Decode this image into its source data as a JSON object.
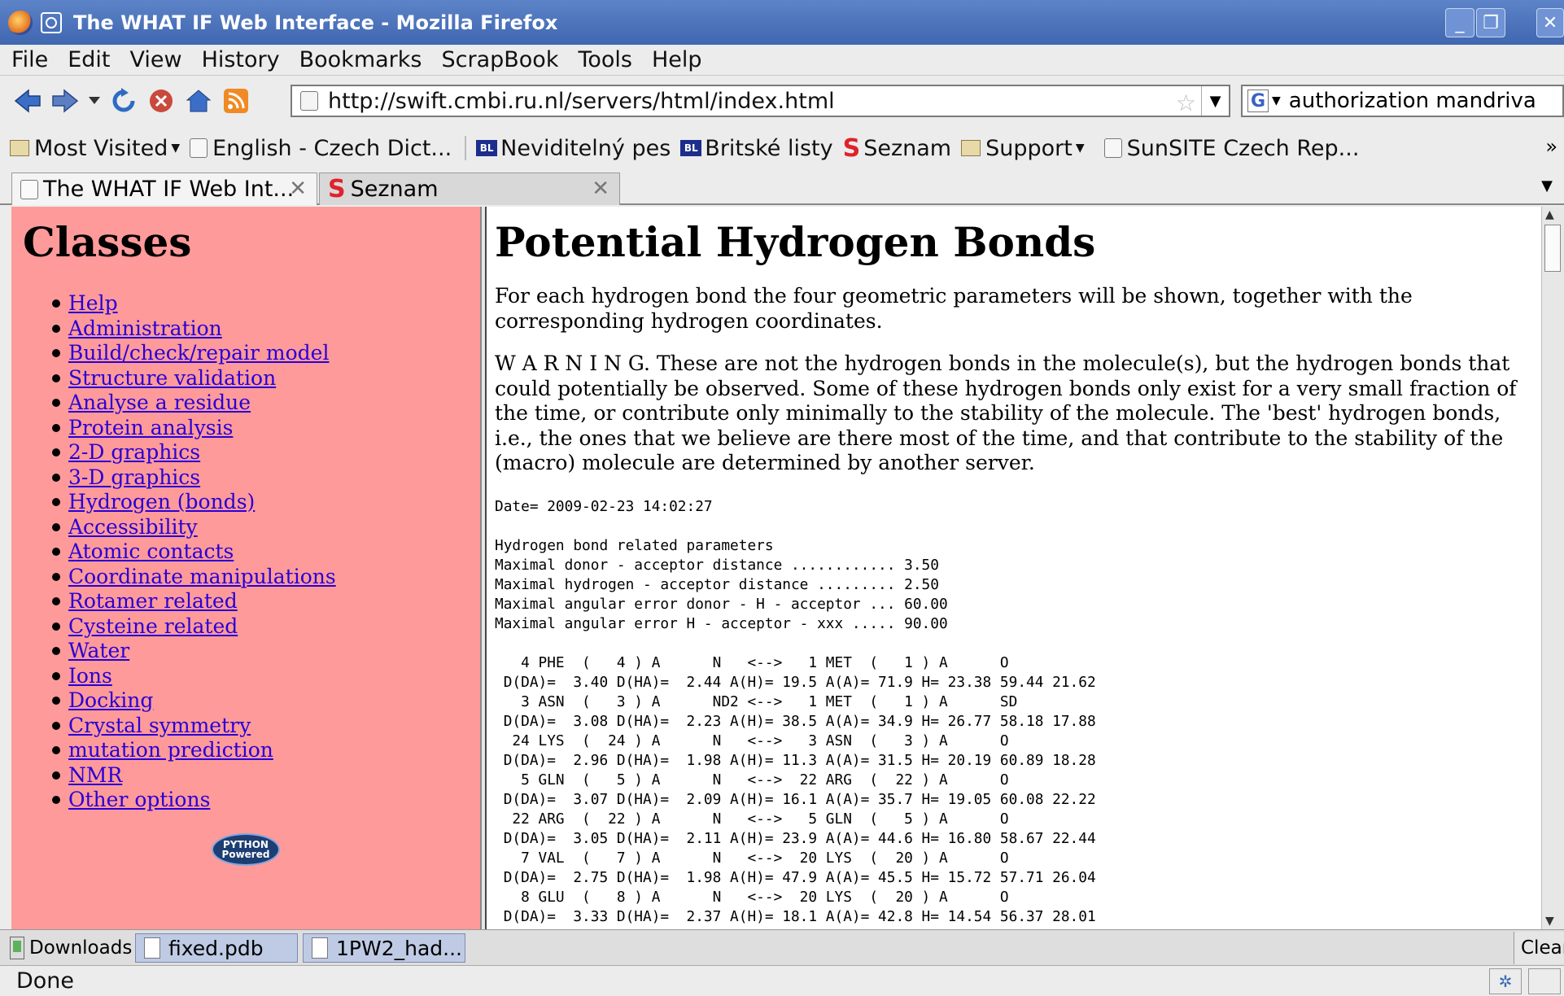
{
  "window": {
    "title": "The WHAT IF Web Interface - Mozilla Firefox",
    "controls": [
      "_",
      "❐",
      "✕"
    ]
  },
  "menu": [
    "File",
    "Edit",
    "View",
    "History",
    "Bookmarks",
    "ScrapBook",
    "Tools",
    "Help"
  ],
  "navigation": {
    "url": "http://swift.cmbi.ru.nl/servers/html/index.html",
    "search_query": "authorization mandriva",
    "search_engine_letter": "G"
  },
  "bookmarks": [
    {
      "label": "Most Visited",
      "icon": "folder-icon",
      "dropdown": true
    },
    {
      "label": "English - Czech Dict...",
      "icon": "page-icon",
      "dropdown": false
    },
    {
      "label": "Neviditelný pes",
      "icon": "bl-icon",
      "dropdown": false
    },
    {
      "label": "Britské listy",
      "icon": "bl-icon",
      "dropdown": false
    },
    {
      "label": "Seznam",
      "icon": "seznam-icon",
      "dropdown": false
    },
    {
      "label": "Support",
      "icon": "folder-icon",
      "dropdown": true
    },
    {
      "label": "SunSITE Czech Rep...",
      "icon": "page-icon",
      "dropdown": false
    }
  ],
  "bookmarks_overflow": "»",
  "tabs": [
    {
      "label": "The WHAT IF Web Int...",
      "active": true
    },
    {
      "label": "Seznam",
      "active": false
    }
  ],
  "sidebar": {
    "title": "Classes",
    "items": [
      "Help",
      "Administration",
      "Build/check/repair model",
      "Structure validation",
      "Analyse a residue",
      "Protein analysis",
      "2-D graphics",
      "3-D graphics",
      "Hydrogen (bonds)",
      "Accessibility",
      "Atomic contacts",
      "Coordinate manipulations",
      "Rotamer related",
      "Cysteine related",
      "Water",
      "Ions",
      "Docking",
      "Crystal symmetry",
      "mutation prediction",
      "NMR",
      "Other options"
    ],
    "badge_line1": "PYTHON",
    "badge_line2": "Powered"
  },
  "main": {
    "title": "Potential Hydrogen Bonds",
    "intro": "For each hydrogen bond the four geometric parameters will be shown, together with the corresponding hydrogen coordinates.",
    "warning": "W A R N I N G. These are not the hydrogen bonds in the molecule(s), but the hydrogen bonds that could potentially be observed. Some of these hydrogen bonds only exist for a very small fraction of the time, or contribute only minimally to the stability of the molecule. The 'best' hydrogen bonds, i.e., the ones that we believe are there most of the time, and that contribute to the stability of the (macro) molecule are determined by another server.",
    "date_line": "Date= 2009-02-23 14:02:27",
    "params_header": "Hydrogen bond related parameters",
    "params": [
      "Maximal donor - acceptor distance ............ 3.50",
      "Maximal hydrogen - acceptor distance ......... 2.50",
      "Maximal angular error donor - H - acceptor ... 60.00",
      "Maximal angular error H - acceptor - xxx ..... 90.00"
    ],
    "hbond_lines": [
      "   4 PHE  (   4 ) A      N   <-->   1 MET  (   1 ) A      O",
      " D(DA)=  3.40 D(HA)=  2.44 A(H)= 19.5 A(A)= 71.9 H= 23.38 59.44 21.62",
      "   3 ASN  (   3 ) A      ND2 <-->   1 MET  (   1 ) A      SD",
      " D(DA)=  3.08 D(HA)=  2.23 A(H)= 38.5 A(A)= 34.9 H= 26.77 58.18 17.88",
      "  24 LYS  (  24 ) A      N   <-->   3 ASN  (   3 ) A      O",
      " D(DA)=  2.96 D(HA)=  1.98 A(H)= 11.3 A(A)= 31.5 H= 20.19 60.89 18.28",
      "   5 GLN  (   5 ) A      N   <-->  22 ARG  (  22 ) A      O",
      " D(DA)=  3.07 D(HA)=  2.09 A(H)= 16.1 A(A)= 35.7 H= 19.05 60.08 22.22",
      "  22 ARG  (  22 ) A      N   <-->   5 GLN  (   5 ) A      O",
      " D(DA)=  3.05 D(HA)=  2.11 A(H)= 23.9 A(A)= 44.6 H= 16.80 58.67 22.44",
      "   7 VAL  (   7 ) A      N   <-->  20 LYS  (  20 ) A      O",
      " D(DA)=  2.75 D(HA)=  1.98 A(H)= 47.9 A(A)= 45.5 H= 15.72 57.71 26.04",
      "   8 GLU  (   8 ) A      N   <-->  20 LYS  (  20 ) A      O",
      " D(DA)=  3.33 D(HA)=  2.37 A(H)= 18.1 A(A)= 42.8 H= 14.54 56.37 28.01"
    ]
  },
  "downloads": {
    "label": "Downloads",
    "items": [
      "fixed.pdb",
      "1PW2_had..."
    ],
    "clear_label": "Clear"
  },
  "status": {
    "text": "Done"
  },
  "colors": {
    "sidebar_bg": "#ff9a9a",
    "link": "#2800d6",
    "titlebar": "#4a70b8"
  }
}
